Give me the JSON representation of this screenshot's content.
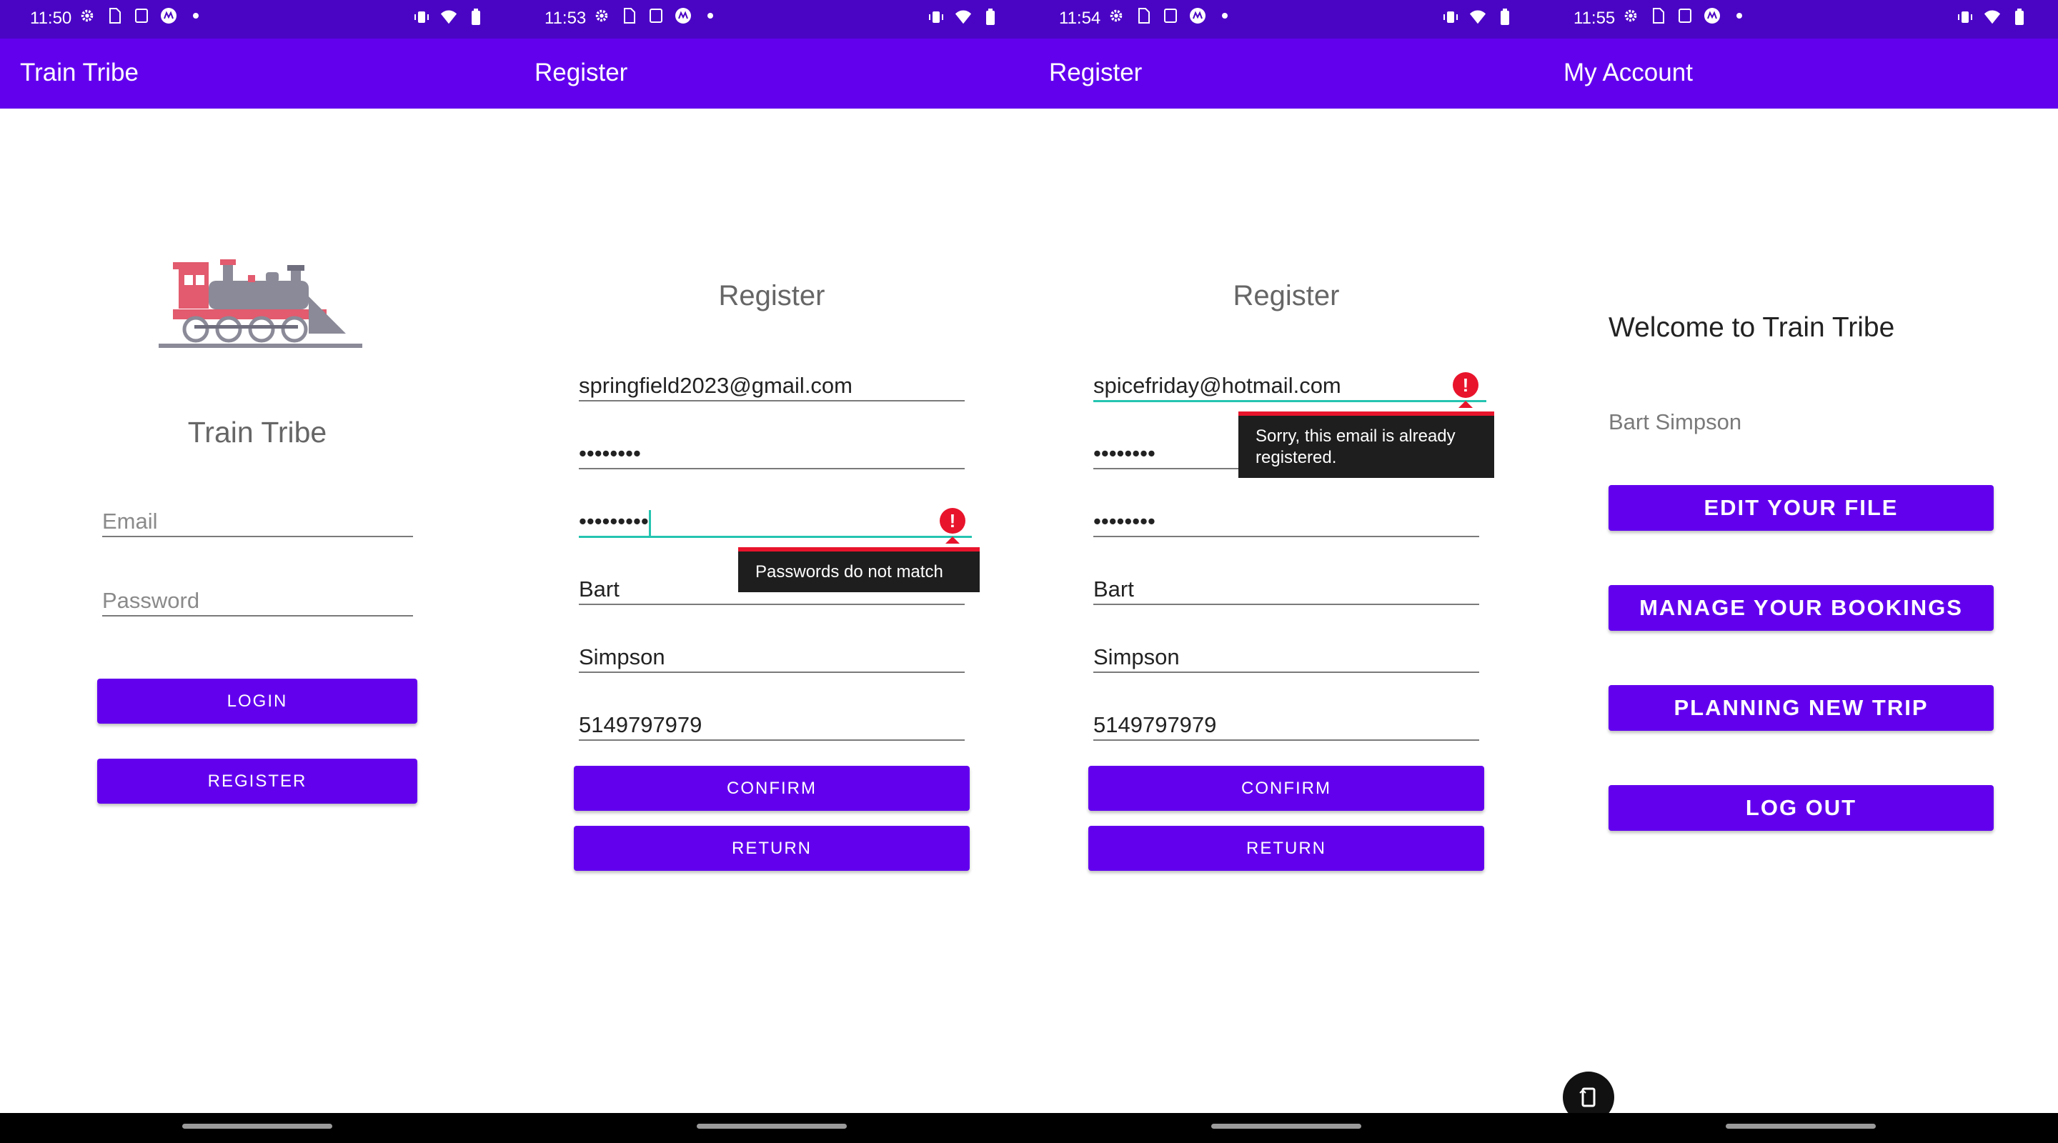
{
  "screens": [
    {
      "status_time": "11:50",
      "app_title": "Train Tribe",
      "brand_name": "Train Tribe",
      "email_placeholder": "Email",
      "password_placeholder": "Password",
      "login_label": "LOGIN",
      "register_label": "REGISTER"
    },
    {
      "status_time": "11:53",
      "app_title": "Register",
      "heading": "Register",
      "email": "springfield2023@gmail.com",
      "password": "••••••••",
      "confirm_password": "•••••••••",
      "error_message": "Passwords do not match",
      "first_name": "Bart",
      "last_name": "Simpson",
      "phone": "5149797979",
      "confirm_label": "CONFIRM",
      "return_label": "RETURN"
    },
    {
      "status_time": "11:54",
      "app_title": "Register",
      "heading": "Register",
      "email": "spicefriday@hotmail.com",
      "password": "••••••••",
      "confirm_password": "••••••••",
      "error_message": "Sorry, this email is already registered.",
      "first_name": "Bart",
      "last_name": "Simpson",
      "phone": "5149797979",
      "confirm_label": "CONFIRM",
      "return_label": "RETURN"
    },
    {
      "status_time": "11:55",
      "app_title": "My Account",
      "welcome": "Welcome to Train Tribe",
      "user_name": "Bart Simpson",
      "edit_label": "EDIT YOUR FILE",
      "manage_label": "MANAGE YOUR BOOKINGS",
      "plan_label": "PLANNING NEW TRIP",
      "logout_label": "LOG OUT"
    }
  ],
  "icons": [
    "settings-icon",
    "sim-icon",
    "screenshot-icon",
    "motorola-icon",
    "dot-icon",
    "vibrate-icon",
    "wifi-icon",
    "battery-icon",
    "error-icon",
    "rotate-icon"
  ],
  "colors": {
    "status_bar": "#4a05c4",
    "app_bar": "#6200ee",
    "button": "#6200ee",
    "error": "#e8142c",
    "focus_line": "#25c4b0"
  }
}
